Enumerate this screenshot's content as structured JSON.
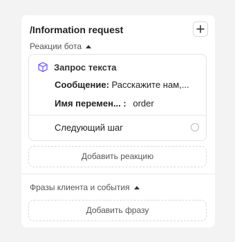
{
  "block": {
    "title": "/Information request"
  },
  "bot_reactions": {
    "label": "Реакции бота",
    "reaction": {
      "title": "Запрос текста",
      "message_label": "Сообщение:",
      "message_value": "Расскажите нам,...",
      "variable_label": "Имя перемен... :",
      "variable_value": "order",
      "next_step_label": "Следующий шаг"
    },
    "add_reaction_label": "Добавить реакцию"
  },
  "client_phrases": {
    "label": "Фразы клиента и события",
    "add_phrase_label": "Добавить фразу"
  },
  "colors": {
    "cube_icon": "#7b61ff",
    "page_bg": "#f3f3f3",
    "card_bg": "#ffffff"
  }
}
